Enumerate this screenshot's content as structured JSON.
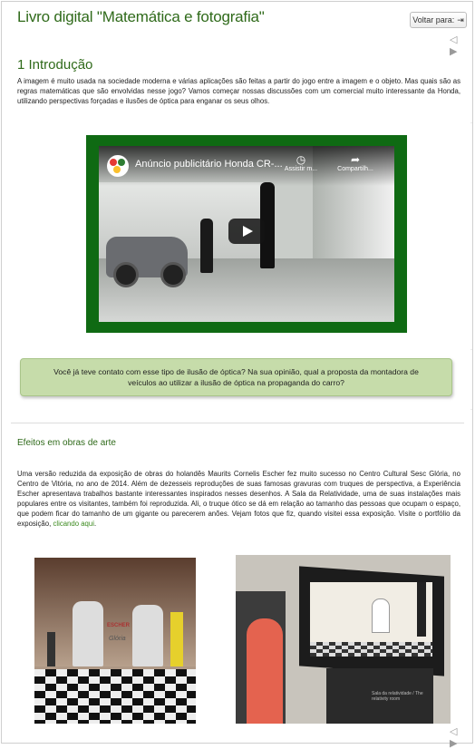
{
  "page": {
    "title": "Livro digital \"Matemática e fotografia\"",
    "voltar_label": "Voltar para:",
    "voltar_icon": "exit-icon",
    "nav_arrows": "◁ ▶"
  },
  "intro": {
    "heading": "1 Introdução",
    "paragraph": "A imagem é muito usada na sociedade moderna e várias aplicações são feitas a partir do jogo entre a imagem e o objeto. Mas quais são as regras matemáticas que são envolvidas nesse jogo? Vamos começar nossas discussões com um comercial muito interessante da Honda, utilizando perspectivas forçadas e ilusões de óptica para enganar os seus olhos."
  },
  "video": {
    "title": "Anúncio publicitário Honda CR-...",
    "watch_later": "Assistir m...",
    "share": "Compartilh...",
    "border_color": "#0f6a13"
  },
  "question": {
    "text": "Você já teve contato com esse tipo de ilusão de óptica? Na sua opinião, qual a proposta da montadora de veículos ao utilizar a ilusão de óptica na propaganda do carro?",
    "bg_color": "#c6dcaa"
  },
  "art": {
    "heading": "Efeitos em obras de arte",
    "paragraph": "Uma versão reduzida da exposição de obras do holandês Maurits Cornelis Escher fez muito sucesso no Centro Cultural Sesc Glória, no Centro de Vitória, no ano de 2014. Além de dezesseis reproduções de suas famosas gravuras com truques de perspectiva, a Experiência Escher apresentava trabalhos bastante interessantes inspirados nesses desenhos. A Sala da Relatividade, uma de suas instalações mais populares entre os visitantes, também foi reproduzida. Ali, o truque ótico se dá em relação ao tamanho das pessoas que ocupam o espaço, que podem ficar do tamanho de um gigante ou parecerem anões. Vejam fotos que fiz, quando visitei essa exposição. Visite o portfólio da exposição,",
    "link_text": "clicando aqui",
    "after_link": "."
  },
  "photos": {
    "photo1_sign": "ESCHER",
    "photo1_sign2": "Glória",
    "photo2_caption": "Sala da relatividade / The relativity room"
  },
  "colors": {
    "heading_green": "#2f6a1a",
    "link_green": "#3b8a1e"
  }
}
